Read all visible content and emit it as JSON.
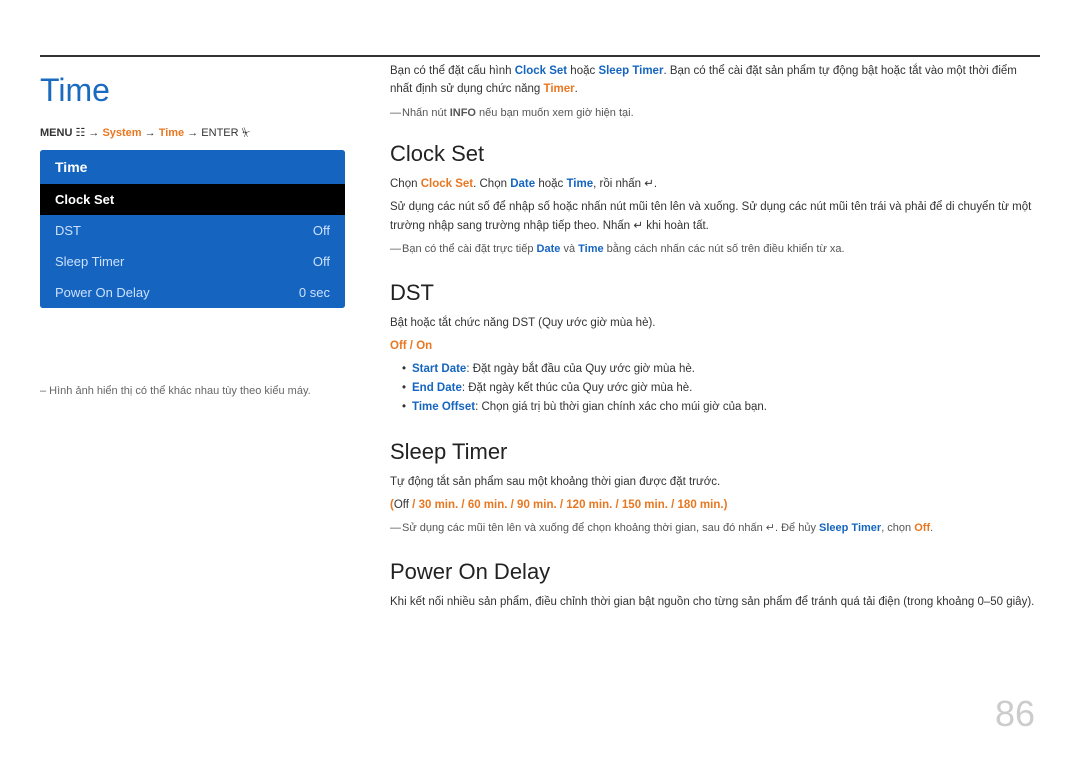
{
  "page": {
    "title": "Time",
    "page_number": "86"
  },
  "menu_path": {
    "text": "MENU",
    "arrow1": "→",
    "system": "System",
    "arrow2": "→",
    "time": "Time",
    "arrow3": "→",
    "enter": "ENTER"
  },
  "tv_menu": {
    "header": "Time",
    "items": [
      {
        "label": "Clock Set",
        "value": "",
        "selected": true
      },
      {
        "label": "DST",
        "value": "Off",
        "selected": false
      },
      {
        "label": "Sleep Timer",
        "value": "Off",
        "selected": false
      },
      {
        "label": "Power On Delay",
        "value": "0 sec",
        "selected": false
      }
    ]
  },
  "footnote": "– Hình ảnh hiển thị có thể khác nhau tùy theo kiểu máy.",
  "intro": {
    "line1": "Bạn có thể đặt cấu hình Clock Set hoặc Sleep Timer. Bạn có thể cài đặt sản phẩm tự động bật hoặc tắt vào một",
    "line2": "thời điểm nhất định sử dụng chức năng Timer.",
    "note": "Nhấn nút INFO nếu bạn muốn xem giờ hiện tại."
  },
  "sections": {
    "clock_set": {
      "title": "Clock Set",
      "para1": "Chọn Clock Set. Chọn Date hoặc Time, rồi nhấn ↵.",
      "para2": "Sử dụng các nút số để nhập số hoặc nhấn nút mũi tên lên và xuống. Sử dụng các nút mũi tên trái và phải để di chuyển từ một trường nhập sang trường nhập tiếp theo. Nhấn ↵ khi hoàn tất.",
      "note": "Bạn có thể cài đặt trực tiếp Date và Time bằng cách nhấn các nút số trên điều khiển từ xa."
    },
    "dst": {
      "title": "DST",
      "para1": "Bật hoặc tắt chức năng DST (Quy ước giờ mùa hè).",
      "options_label": "Off / On",
      "bullets": [
        "Start Date: Đặt ngày bắt đầu của Quy ước giờ mùa hè.",
        "End Date: Đặt ngày kết thúc của Quy ước giờ mùa hè.",
        "Time Offset: Chọn giá trị bù thời gian chính xác cho múi giờ của bạn."
      ]
    },
    "sleep_timer": {
      "title": "Sleep Timer",
      "para1": "Tự động tắt sản phẩm sau một khoảng thời gian được đặt trước.",
      "options": "(Off / 30 min. / 60 min. / 90 min. / 120 min. / 150 min. / 180 min.)",
      "note": "Sử dụng các mũi tên lên và xuống để chọn khoảng thời gian, sau đó nhấn ↵. Để hủy Sleep Timer, chọn Off."
    },
    "power_on_delay": {
      "title": "Power On Delay",
      "para1": "Khi kết nối nhiều sản phẩm, điều chỉnh thời gian bật nguồn cho từng sản phẩm để tránh quá tải điện (trong khoảng 0–50 giây)."
    }
  }
}
